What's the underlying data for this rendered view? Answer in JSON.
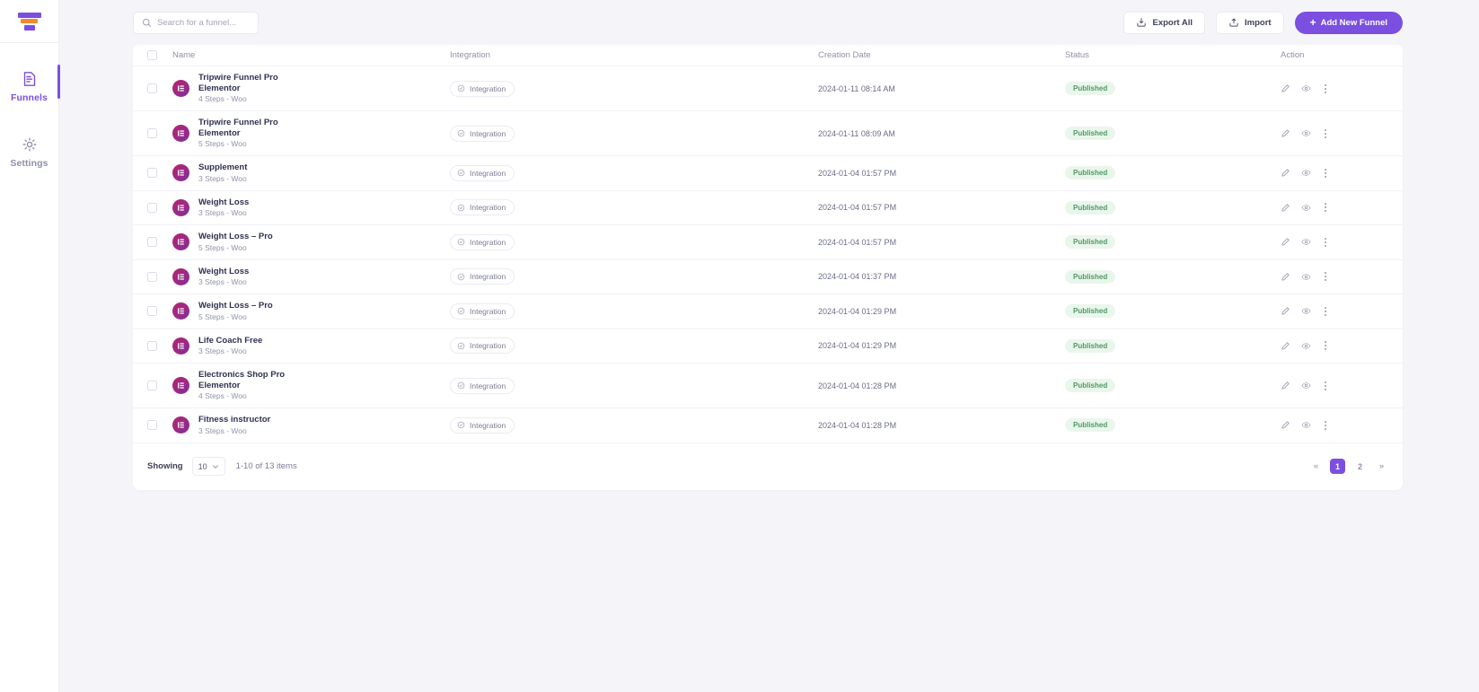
{
  "sidebar": {
    "logo_name": "funnel-logo",
    "items": [
      {
        "label": "Funnels",
        "icon": "document-list-icon",
        "active": true
      },
      {
        "label": "Settings",
        "icon": "gear-icon",
        "active": false
      }
    ]
  },
  "topbar": {
    "search_placeholder": "Search for a funnel...",
    "search_value": "",
    "export_all_label": "Export All",
    "import_label": "Import",
    "add_new_label": "Add New Funnel",
    "add_new_plus": "+",
    "primary_color": "#7b4fe0"
  },
  "table": {
    "columns": [
      "Name",
      "Integration",
      "Creation Date",
      "Status",
      "Action"
    ],
    "rows": [
      {
        "name": "Tripwire Funnel Pro Elementor",
        "sub": "4 Steps - Woo",
        "integration": "Integration",
        "date": "2024-01-11 08:14 AM",
        "status": "Published"
      },
      {
        "name": "Tripwire Funnel Pro Elementor",
        "sub": "5 Steps - Woo",
        "integration": "Integration",
        "date": "2024-01-11 08:09 AM",
        "status": "Published"
      },
      {
        "name": "Supplement",
        "sub": "3 Steps - Woo",
        "integration": "Integration",
        "date": "2024-01-04 01:57 PM",
        "status": "Published"
      },
      {
        "name": "Weight Loss",
        "sub": "3 Steps - Woo",
        "integration": "Integration",
        "date": "2024-01-04 01:57 PM",
        "status": "Published"
      },
      {
        "name": "Weight Loss – Pro",
        "sub": "5 Steps - Woo",
        "integration": "Integration",
        "date": "2024-01-04 01:57 PM",
        "status": "Published"
      },
      {
        "name": "Weight Loss",
        "sub": "3 Steps - Woo",
        "integration": "Integration",
        "date": "2024-01-04 01:37 PM",
        "status": "Published"
      },
      {
        "name": "Weight Loss – Pro",
        "sub": "5 Steps - Woo",
        "integration": "Integration",
        "date": "2024-01-04 01:29 PM",
        "status": "Published"
      },
      {
        "name": "Life Coach Free",
        "sub": "3 Steps - Woo",
        "integration": "Integration",
        "date": "2024-01-04 01:29 PM",
        "status": "Published"
      },
      {
        "name": "Electronics Shop Pro Elementor",
        "sub": "4 Steps - Woo",
        "integration": "Integration",
        "date": "2024-01-04 01:28 PM",
        "status": "Published"
      },
      {
        "name": "Fitness instructor",
        "sub": "3 Steps - Woo",
        "integration": "Integration",
        "date": "2024-01-04 01:28 PM",
        "status": "Published"
      }
    ],
    "status_color": "#4e9a62",
    "status_bg": "#eaf6ec",
    "actions": [
      "edit-pencil-icon",
      "eye-preview-icon",
      "more-options-icon"
    ]
  },
  "footer": {
    "showing_label": "Showing",
    "per_page_value": "10",
    "range_text": "1-10 of 13 items",
    "first_page_icon": "«",
    "last_page_icon": "»",
    "pages": [
      "1",
      "2"
    ],
    "current_page": "1"
  }
}
